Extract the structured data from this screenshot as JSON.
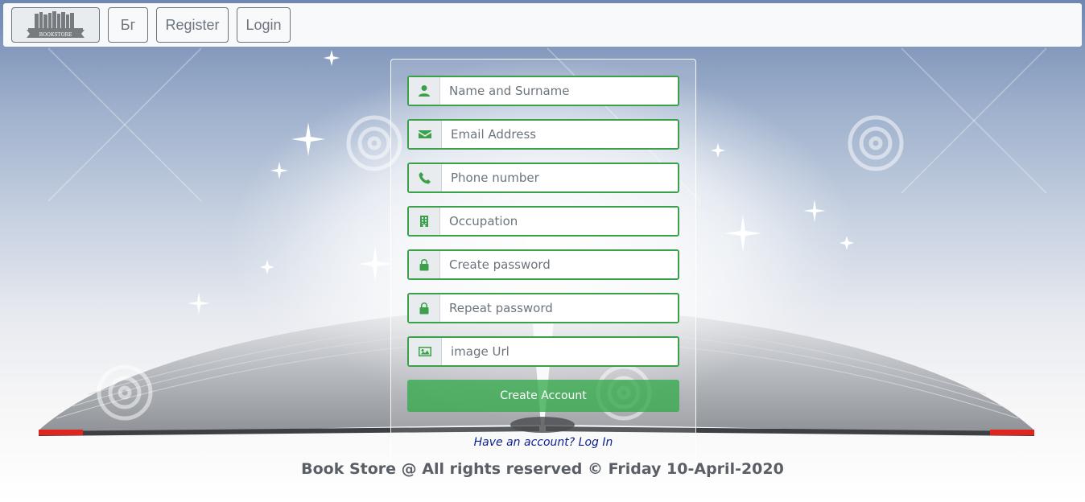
{
  "navbar": {
    "brand_text": "BOOKSTORE",
    "language_label": "Бг",
    "register_label": "Register",
    "login_label": "Login"
  },
  "form": {
    "fields": [
      {
        "icon": "user-icon",
        "placeholder": "Name and Surname"
      },
      {
        "icon": "envelope-icon",
        "placeholder": "Email Address"
      },
      {
        "icon": "phone-icon",
        "placeholder": "Phone number"
      },
      {
        "icon": "building-icon",
        "placeholder": "Occupation"
      },
      {
        "icon": "lock-icon",
        "placeholder": "Create password"
      },
      {
        "icon": "lock-icon",
        "placeholder": "Repeat password"
      },
      {
        "icon": "image-icon",
        "placeholder": "image Url"
      }
    ],
    "submit_label": "Create Account",
    "login_link": "Have an account? Log In"
  },
  "footer": {
    "text": "Book Store @ All rights reserved © Friday 10-April-2020"
  },
  "colors": {
    "accent": "#3aa14a",
    "link": "#0b1f8c",
    "footer_text": "#5a5f66"
  }
}
